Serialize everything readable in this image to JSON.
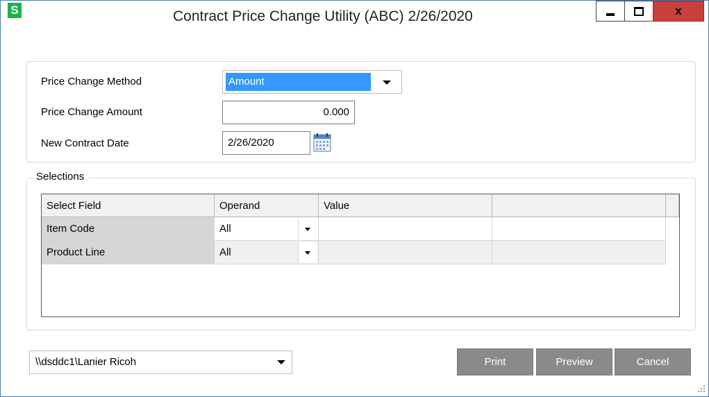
{
  "window": {
    "app_icon_letter": "S",
    "title": "Contract Price Change Utility (ABC) 2/26/2020",
    "close_glyph": "x",
    "accent_color": "#3399ff",
    "close_color": "#c9403a",
    "button_color": "#8a8a8a"
  },
  "form": {
    "method_label": "Price Change Method",
    "method_value": "Amount",
    "amount_label": "Price Change Amount",
    "amount_value": "0.000",
    "date_label": "New Contract Date",
    "date_value": "2/26/2020",
    "calendar_icon": "calendar-icon"
  },
  "selections": {
    "legend": "Selections",
    "columns": [
      "Select Field",
      "Operand",
      "Value",
      ""
    ],
    "rows": [
      {
        "field": "Item Code",
        "operand": "All",
        "value": ""
      },
      {
        "field": "Product Line",
        "operand": "All",
        "value": ""
      }
    ]
  },
  "footer": {
    "printer": "\\\\dsddc1\\Lanier Ricoh",
    "print_label": "Print",
    "preview_label": "Preview",
    "cancel_label": "Cancel"
  }
}
